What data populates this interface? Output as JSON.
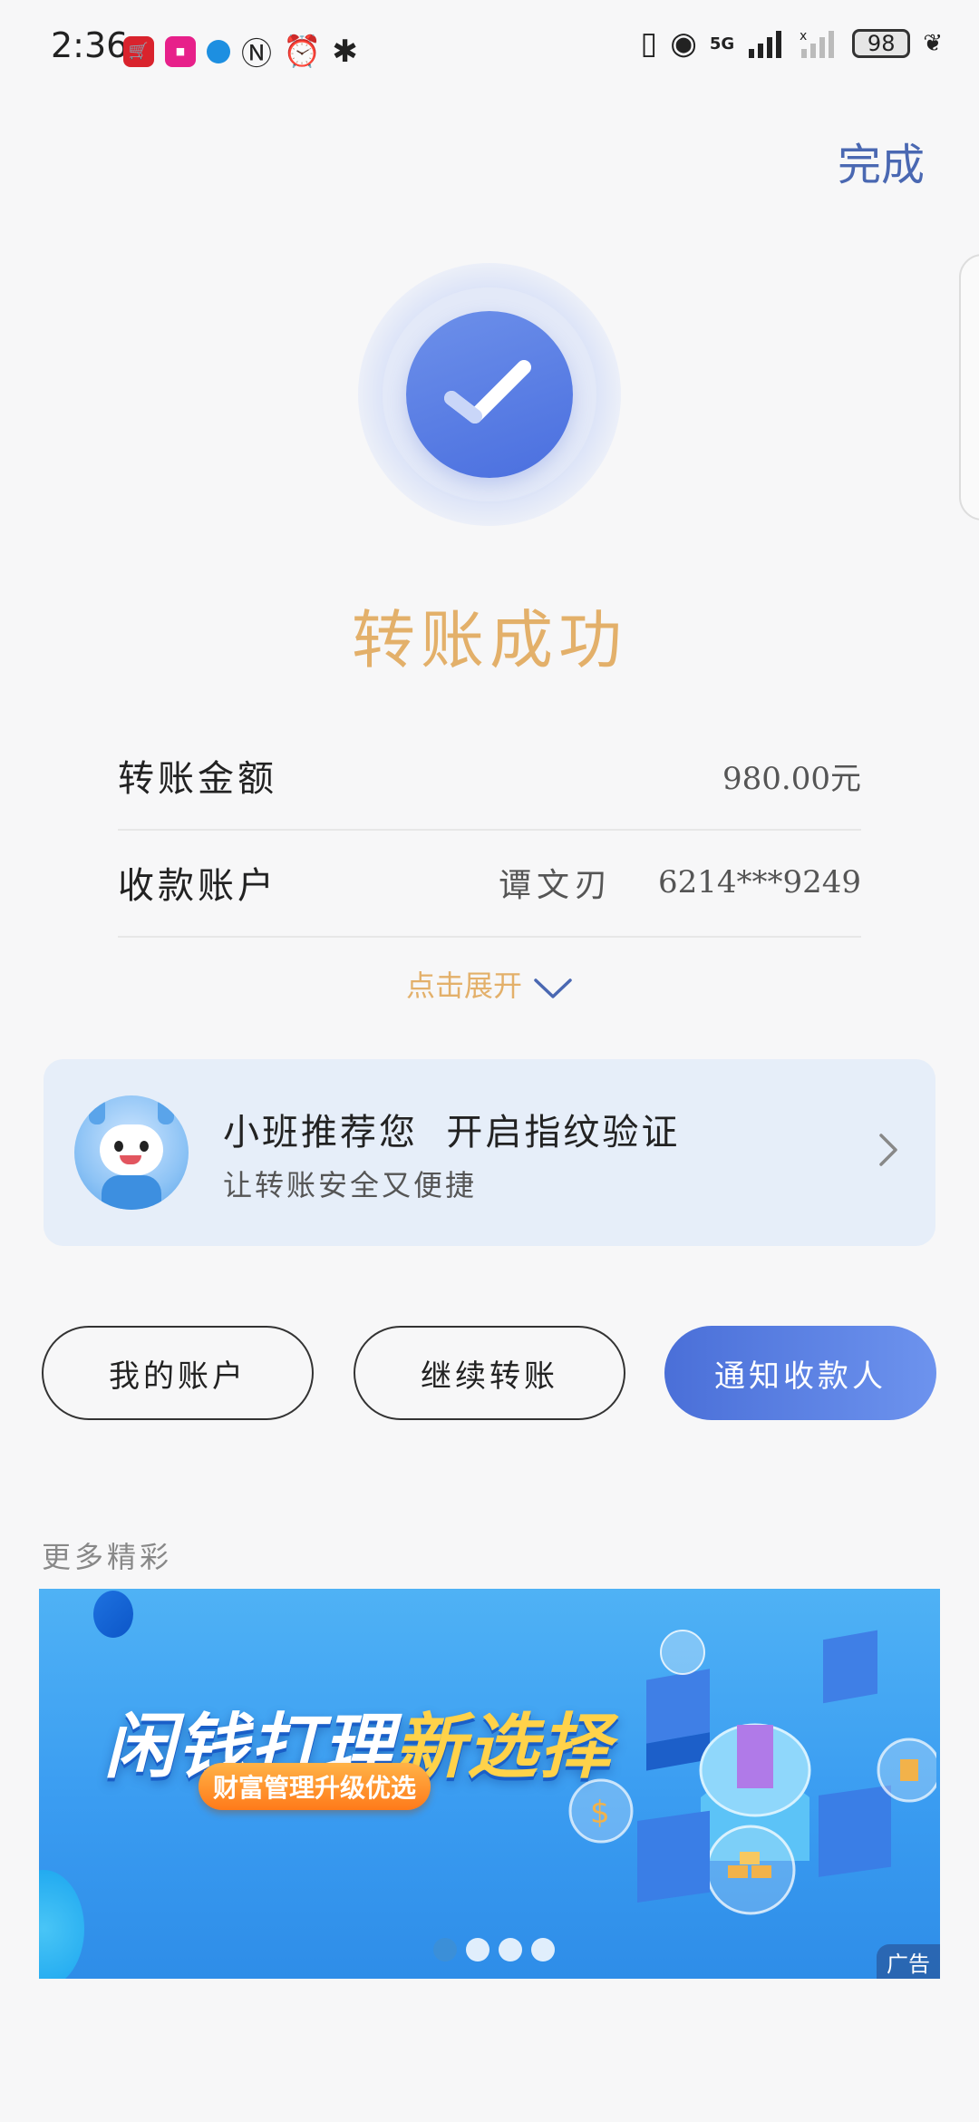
{
  "status_bar": {
    "time": "2:36",
    "battery": "98",
    "network": "5G",
    "sim_slot": "1"
  },
  "header": {
    "done_label": "完成"
  },
  "result": {
    "title": "转账成功"
  },
  "details": {
    "amount_label": "转账金额",
    "amount_value": "980.00元",
    "account_label": "收款账户",
    "payee_name": "谭文刃",
    "account_number": "6214***9249"
  },
  "expand": {
    "label": "点击展开"
  },
  "promo": {
    "title": "小班推荐您  开启指纹验证",
    "subtitle": "让转账安全又便捷"
  },
  "actions": {
    "my_account": "我的账户",
    "continue_transfer": "继续转账",
    "notify_payee": "通知收款人"
  },
  "more": {
    "label": "更多精彩"
  },
  "banner": {
    "headline_part1": "闲钱打理",
    "headline_part2": "新选择",
    "pill": "财富管理升级优选",
    "ad_badge": "广告",
    "dots_count": 4,
    "active_dot": 1
  },
  "colors": {
    "accent_blue": "#4a6fdf",
    "gold": "#e3b06a",
    "done_blue": "#4a68b2"
  }
}
